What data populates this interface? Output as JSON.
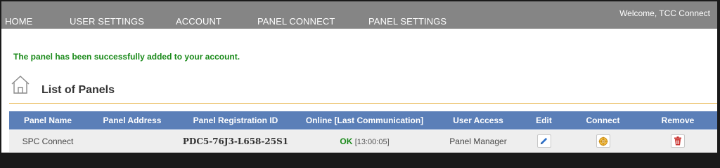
{
  "nav": {
    "items": [
      {
        "label": "HOME"
      },
      {
        "label": "USER SETTINGS"
      },
      {
        "label": "ACCOUNT"
      },
      {
        "label": "PANEL CONNECT"
      },
      {
        "label": "PANEL SETTINGS"
      }
    ],
    "welcome": "Welcome, TCC Connect"
  },
  "message": "The panel has been successfully added to your account.",
  "section": {
    "title": "List of Panels",
    "icon": "home-icon"
  },
  "table": {
    "headers": {
      "panel_name": "Panel Name",
      "panel_address": "Panel Address",
      "registration_id": "Panel Registration ID",
      "online": "Online [Last Communication]",
      "user_access": "User Access",
      "edit": "Edit",
      "connect": "Connect",
      "remove": "Remove"
    },
    "rows": [
      {
        "panel_name": "SPC Connect",
        "panel_address": "",
        "registration_id": "PDC5-76J3-L658-25S1",
        "online_status": "OK",
        "last_communication": "[13:00:05]",
        "user_access": "Panel Manager",
        "edit_icon": "pencil-icon",
        "connect_icon": "target-icon",
        "remove_icon": "trash-icon"
      }
    ]
  },
  "colors": {
    "nav_bg": "#858585",
    "table_header_bg": "#5b7fb8",
    "success_green": "#1a8a1a",
    "rule_orange": "#e8b54a"
  }
}
